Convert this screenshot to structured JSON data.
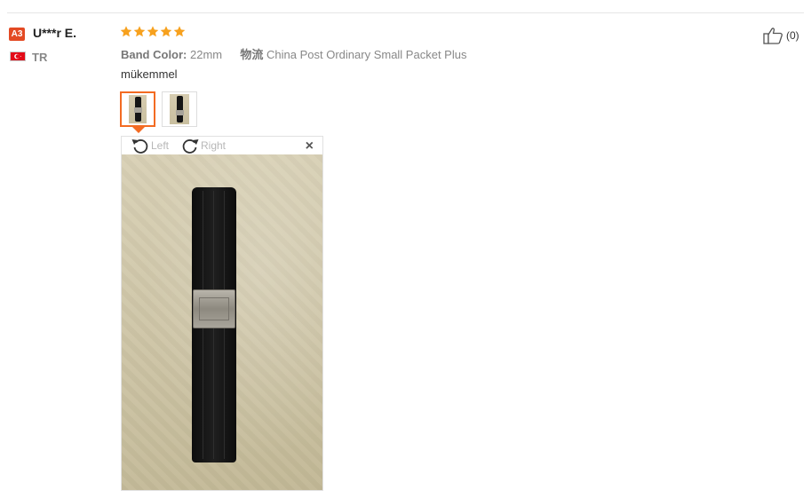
{
  "review": {
    "user": {
      "level_badge": "A3",
      "name": "U***r E.",
      "country_code": "TR",
      "flag_icon": "turkey-flag-icon"
    },
    "rating": {
      "stars": 5,
      "max": 5,
      "color": "#f7a11e"
    },
    "attributes": {
      "band_color_label": "Band Color:",
      "band_color_value": "22mm",
      "logistics_label": "物流",
      "logistics_value": "China Post Ordinary Small Packet Plus"
    },
    "text": "mükemmel",
    "images": {
      "thumbnails": [
        {
          "name": "review-thumbnail-1",
          "selected": true
        },
        {
          "name": "review-thumbnail-2",
          "selected": false
        }
      ],
      "viewer": {
        "rotate_left_label": "Left",
        "rotate_right_label": "Right",
        "close_glyph": "×"
      }
    },
    "helpful": {
      "count_text": "(0)"
    }
  },
  "colors": {
    "accent": "#f36b22",
    "badge": "#e34a24",
    "muted_text": "#888888"
  }
}
